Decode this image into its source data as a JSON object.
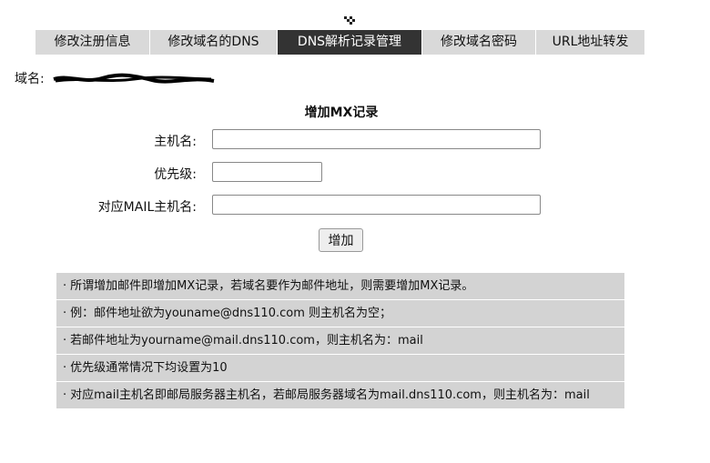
{
  "top_icon": "checker-icon",
  "tabs": [
    {
      "label": "修改注册信息",
      "active": false
    },
    {
      "label": "修改域名的DNS",
      "active": false
    },
    {
      "label": "DNS解析记录管理",
      "active": true
    },
    {
      "label": "修改域名密码",
      "active": false
    },
    {
      "label": "URL地址转发",
      "active": false
    }
  ],
  "domain": {
    "label": "域名:"
  },
  "form": {
    "title": "增加MX记录",
    "host_label": "主机名:",
    "host_value": "",
    "priority_label": "优先级:",
    "priority_value": "",
    "mail_host_label": "对应MAIL主机名:",
    "mail_host_value": "",
    "submit_label": "增加"
  },
  "notes": [
    {
      "bullet": "·",
      "text": "所谓增加邮件即增加MX记录，若域名要作为邮件地址，则需要增加MX记录。"
    },
    {
      "bullet": "·",
      "text": "例：邮件地址欲为youname@dns110.com 则主机名为空；"
    },
    {
      "bullet": "·",
      "text": "若邮件地址为yourname@mail.dns110.com，则主机名为：mail"
    },
    {
      "bullet": "·",
      "text": "优先级通常情况下均设置为10"
    },
    {
      "bullet": "·",
      "text": "对应mail主机名即邮局服务器主机名，若邮局服务器域名为mail.dns110.com，则主机名为：mail"
    }
  ],
  "colors": {
    "tab_bg": "#d9d9d9",
    "tab_active_bg": "#333333",
    "note_bg": "#d3d3d3"
  }
}
